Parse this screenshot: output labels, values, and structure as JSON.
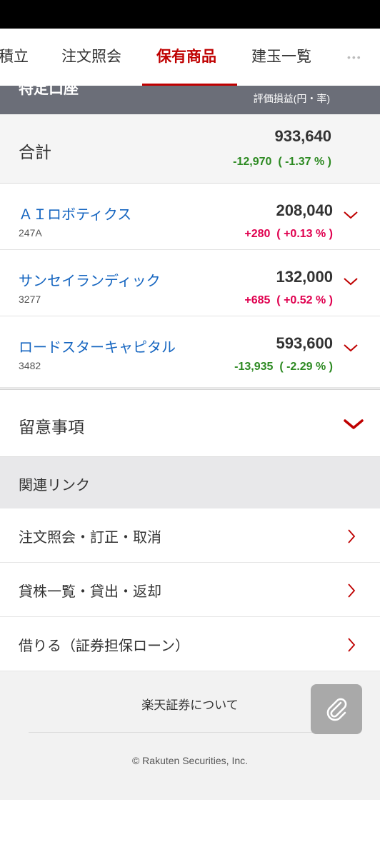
{
  "tabs": [
    {
      "label": "積立",
      "active": false
    },
    {
      "label": "注文照会",
      "active": false
    },
    {
      "label": "保有商品",
      "active": true
    },
    {
      "label": "建玉一覧",
      "active": false
    }
  ],
  "more_dots": "•••",
  "account": {
    "title": "特定口座",
    "column_label": "評価損益(円・率)"
  },
  "total": {
    "label": "合計",
    "value": "933,640",
    "change": "-12,970",
    "change_pct": "( -1.37 % )"
  },
  "stocks": [
    {
      "name": "ＡＩロボティクス",
      "code": "247A",
      "value": "208,040",
      "change": "+280",
      "change_pct": "( +0.13 % )",
      "direction": "pos"
    },
    {
      "name": "サンセイランディック",
      "code": "3277",
      "value": "132,000",
      "change": "+685",
      "change_pct": "( +0.52 % )",
      "direction": "pos"
    },
    {
      "name": "ロードスターキャピタル",
      "code": "3482",
      "value": "593,600",
      "change": "-13,935",
      "change_pct": "( -2.29 % )",
      "direction": "neg"
    }
  ],
  "notes": {
    "label": "留意事項"
  },
  "related": {
    "header": "関連リンク",
    "links": [
      {
        "label": "注文照会・訂正・取消"
      },
      {
        "label": "貸株一覧・貸出・返却"
      },
      {
        "label": "借りる（証券担保ローン）"
      }
    ]
  },
  "footer": {
    "about": "楽天証券について",
    "copyright": "© Rakuten Securities, Inc."
  },
  "colors": {
    "accent": "#bf0000",
    "positive": "#e0004f",
    "negative": "#2d8a22",
    "link": "#1565c0"
  },
  "icons": {
    "stock_expand": "chevron-down-icon",
    "notes_expand": "chevron-down-icon",
    "link_arrow": "chevron-right-icon",
    "attach": "paperclip-icon"
  }
}
